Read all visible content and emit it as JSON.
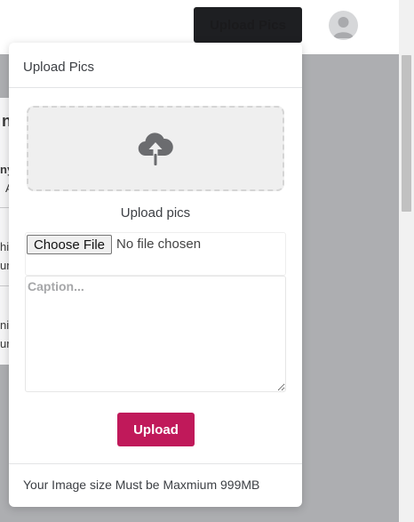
{
  "header": {
    "upload_button_label": "Upload Pics"
  },
  "background_page": {
    "fragments": [
      "n C",
      "ny",
      "A",
      "hi",
      "ur",
      "nis",
      "ur"
    ]
  },
  "modal": {
    "title": "Upload Pics",
    "dropzone_icon": "cloud-upload-icon",
    "dropzone_label": "Upload pics",
    "file_input": {
      "button_label": "Choose File",
      "status": "No file chosen"
    },
    "caption": {
      "placeholder": "Caption..."
    },
    "upload_button_label": "Upload",
    "footer_note": "Your Image size Must be Maxmium 999MB"
  },
  "colors": {
    "primary_button": "#c0195a",
    "dark_button": "#1e1f22",
    "overlay": "#adaeb1"
  }
}
